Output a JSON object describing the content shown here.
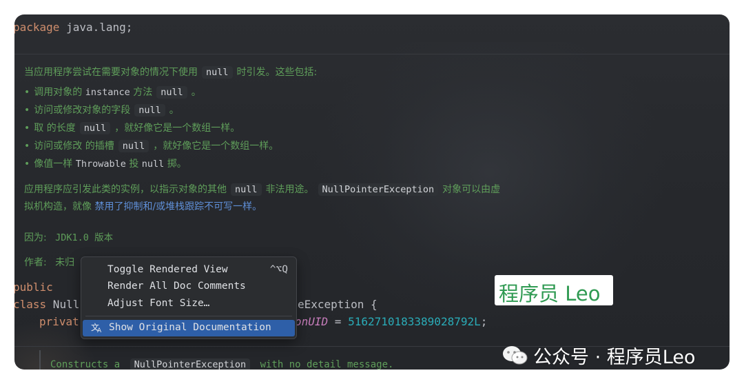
{
  "code": {
    "package_kw": "package",
    "package_name": " java.lang;",
    "public_kw": "public",
    "class_kw": "class",
    "class_name_fragment": " Null",
    "class_tail": "eException {",
    "private_fragment": "privat",
    "field_fragment": "onUID",
    "field_assign": " = ",
    "field_value": "5162710183389028792L",
    "field_end": ";"
  },
  "doc": {
    "intro_pre": "当应用程序尝试在需要对象的情况下使用",
    "intro_code": "null",
    "intro_post": "时引发。这些包括:",
    "bullets": [
      {
        "pre": "调用对象的 ",
        "mono": "instance",
        "mid": " 方法",
        "code": "null",
        "post": "。"
      },
      {
        "pre": "访问或修改对象的字段",
        "code": "null",
        "post": "。"
      },
      {
        "pre": "取  的长度",
        "code": "null",
        "post": "，就好像它是一个数组一样。"
      },
      {
        "pre": "访问或修改  的插槽",
        "code": "null",
        "post": "，就好像它是一个数组一样。"
      },
      {
        "pre": "像值一样 ",
        "mono": "Throwable",
        "mid": " 投 ",
        "mono2": "null",
        "post": " 掷。"
      }
    ],
    "para2_pre": "应用程序应引发此类的实例，以指示对象的其他",
    "para2_code1": "null",
    "para2_mid": "非法用途。",
    "para2_code2": "NullPointerException",
    "para2_post": "对象可以由虚",
    "para2_line2_pre": "拟机构造，就像 ",
    "para2_link": "禁用了抑制和/或堆栈跟踪不可写一样。",
    "since_label": "因为:",
    "since_value": "JDK1.0 版本",
    "author_label": "作者:",
    "author_value": "未归",
    "ctor_pre": "Constructs a ",
    "ctor_code": "NullPointerException",
    "ctor_post": " with no detail message."
  },
  "menu": {
    "items": [
      {
        "label": "Toggle Rendered View",
        "shortcut": "^⌥Q"
      },
      {
        "label": "Render All Doc Comments",
        "shortcut": ""
      },
      {
        "label": "Adjust Font Size…",
        "shortcut": ""
      },
      {
        "label": "Show Original Documentation",
        "shortcut": "",
        "icon": "translate-icon"
      }
    ]
  },
  "watermark": {
    "badge_text": "程序员 Leo",
    "wechat_text": "公众号 · 程序员Leo",
    "wechat_icon": "wechat-icon"
  },
  "colors": {
    "editor_bg": "#2b2d31",
    "doc_green": "#5f9e5a",
    "keyword_orange": "#cf8e6d",
    "number_cyan": "#2aacb8",
    "menu_selected": "#2e5fa8",
    "badge_green": "#2f9a52"
  }
}
